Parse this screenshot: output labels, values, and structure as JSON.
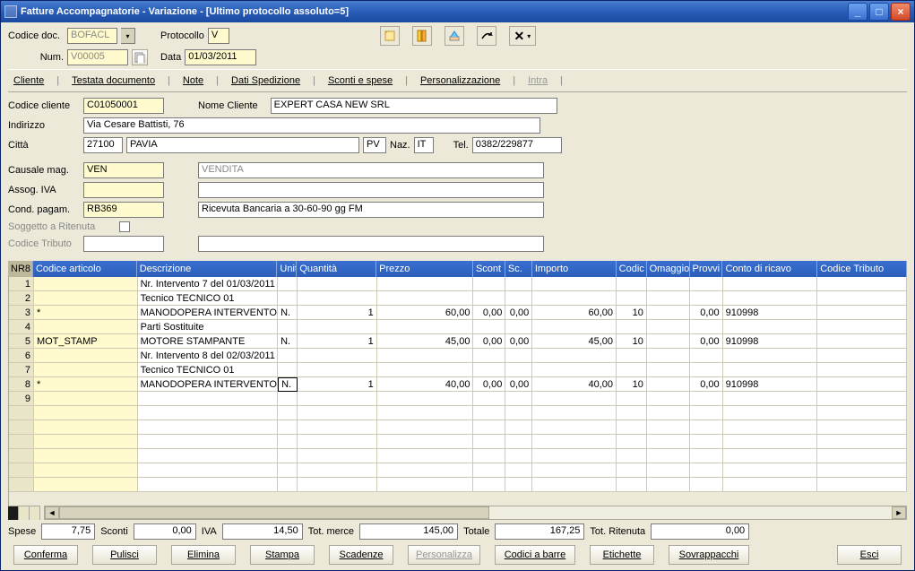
{
  "window": {
    "title": "Fatture Accompagnatorie - Variazione - [Ultimo protocollo assoluto=5]"
  },
  "toolbar": {
    "codice_doc_label": "Codice doc.",
    "codice_doc_value": "BOFACL",
    "protocollo_label": "Protocollo",
    "protocollo_value": "V",
    "num_label": "Num.",
    "num_value": "V00005",
    "data_label": "Data",
    "data_value": "01/03/2011"
  },
  "tabs": {
    "cliente": "Cliente",
    "testata": "Testata documento",
    "note": "Note",
    "dati_sped": "Dati Spedizione",
    "sconti": "Sconti e spese",
    "personal": "Personalizzazione",
    "intra": "Intra"
  },
  "cliente": {
    "codice_label": "Codice cliente",
    "codice_value": "C01050001",
    "nome_label": "Nome Cliente",
    "nome_value": "EXPERT CASA NEW SRL",
    "indirizzo_label": "Indirizzo",
    "indirizzo_value": "Via Cesare Battisti, 76",
    "citta_label": "Città",
    "cap_value": "27100",
    "citta_value": "PAVIA",
    "prov_value": "PV",
    "naz_label": "Naz.",
    "naz_value": "IT",
    "tel_label": "Tel.",
    "tel_value": "0382/229877",
    "causale_label": "Causale mag.",
    "causale_value": "VEN",
    "causale_desc": "VENDITA",
    "assog_label": "Assog. IVA",
    "cond_label": "Cond. pagam.",
    "cond_value": "RB369",
    "cond_desc": "Ricevuta Bancaria a 30-60-90 gg FM",
    "soggetto_label": "Soggetto a Ritenuta",
    "tributo_label": "Codice Tributo"
  },
  "grid": {
    "headers": {
      "nr": "NR8",
      "art": "Codice articolo",
      "des": "Descrizione",
      "um": "Unit",
      "qt": "Quantità",
      "pr": "Prezzo",
      "sc": "Scont",
      "sc2": "Sc.",
      "imp": "Importo",
      "cod": "Codic",
      "om": "Omaggio",
      "pv": "Provvi",
      "cr": "Conto di ricavo",
      "ct": "Codice Tributo"
    },
    "rows": [
      {
        "n": "1",
        "art": "",
        "des": "Nr. Intervento 7 del 01/03/2011",
        "um": "",
        "qt": "",
        "pr": "",
        "sc": "",
        "sc2": "",
        "imp": "",
        "cod": "",
        "om": "",
        "pv": "",
        "cr": "",
        "ct": ""
      },
      {
        "n": "2",
        "art": "",
        "des": "Tecnico TECNICO 01",
        "um": "",
        "qt": "",
        "pr": "",
        "sc": "",
        "sc2": "",
        "imp": "",
        "cod": "",
        "om": "",
        "pv": "",
        "cr": "",
        "ct": ""
      },
      {
        "n": "3",
        "art": "*",
        "des": "MANODOPERA INTERVENTO",
        "um": "N.",
        "qt": "1",
        "pr": "60,00",
        "sc": "0,00",
        "sc2": "0,00",
        "imp": "60,00",
        "cod": "10",
        "om": "",
        "pv": "0,00",
        "cr": "910998",
        "ct": ""
      },
      {
        "n": "4",
        "art": "",
        "des": "Parti Sostituite",
        "um": "",
        "qt": "",
        "pr": "",
        "sc": "",
        "sc2": "",
        "imp": "",
        "cod": "",
        "om": "",
        "pv": "",
        "cr": "",
        "ct": ""
      },
      {
        "n": "5",
        "art": "MOT_STAMP",
        "des": "MOTORE STAMPANTE",
        "um": "N.",
        "qt": "1",
        "pr": "45,00",
        "sc": "0,00",
        "sc2": "0,00",
        "imp": "45,00",
        "cod": "10",
        "om": "",
        "pv": "0,00",
        "cr": "910998",
        "ct": ""
      },
      {
        "n": "6",
        "art": "",
        "des": "Nr. Intervento 8 del 02/03/2011",
        "um": "",
        "qt": "",
        "pr": "",
        "sc": "",
        "sc2": "",
        "imp": "",
        "cod": "",
        "om": "",
        "pv": "",
        "cr": "",
        "ct": ""
      },
      {
        "n": "7",
        "art": "",
        "des": "Tecnico TECNICO 01",
        "um": "",
        "qt": "",
        "pr": "",
        "sc": "",
        "sc2": "",
        "imp": "",
        "cod": "",
        "om": "",
        "pv": "",
        "cr": "",
        "ct": ""
      },
      {
        "n": "8",
        "art": "*",
        "des": "MANODOPERA INTERVENTO",
        "um": "N.",
        "qt": "1",
        "pr": "40,00",
        "sc": "0,00",
        "sc2": "0,00",
        "imp": "40,00",
        "cod": "10",
        "om": "",
        "pv": "0,00",
        "cr": "910998",
        "ct": "",
        "active": true
      },
      {
        "n": "9",
        "art": "",
        "des": "",
        "um": "",
        "qt": "",
        "pr": "",
        "sc": "",
        "sc2": "",
        "imp": "",
        "cod": "",
        "om": "",
        "pv": "",
        "cr": "",
        "ct": ""
      }
    ]
  },
  "totals": {
    "spese_label": "Spese",
    "spese_value": "7,75",
    "sconti_label": "Sconti",
    "sconti_value": "0,00",
    "iva_label": "IVA",
    "iva_value": "14,50",
    "merce_label": "Tot. merce",
    "merce_value": "145,00",
    "totale_label": "Totale",
    "totale_value": "167,25",
    "rit_label": "Tot. Ritenuta",
    "rit_value": "0,00"
  },
  "buttons": {
    "conferma": "Conferma",
    "pulisci": "Pulisci",
    "elimina": "Elimina",
    "stampa": "Stampa",
    "scadenze": "Scadenze",
    "personalizza": "Personalizza",
    "codici": "Codici a barre",
    "etichette": "Etichette",
    "sovrap": "Sovrappacchi",
    "esci": "Esci"
  }
}
